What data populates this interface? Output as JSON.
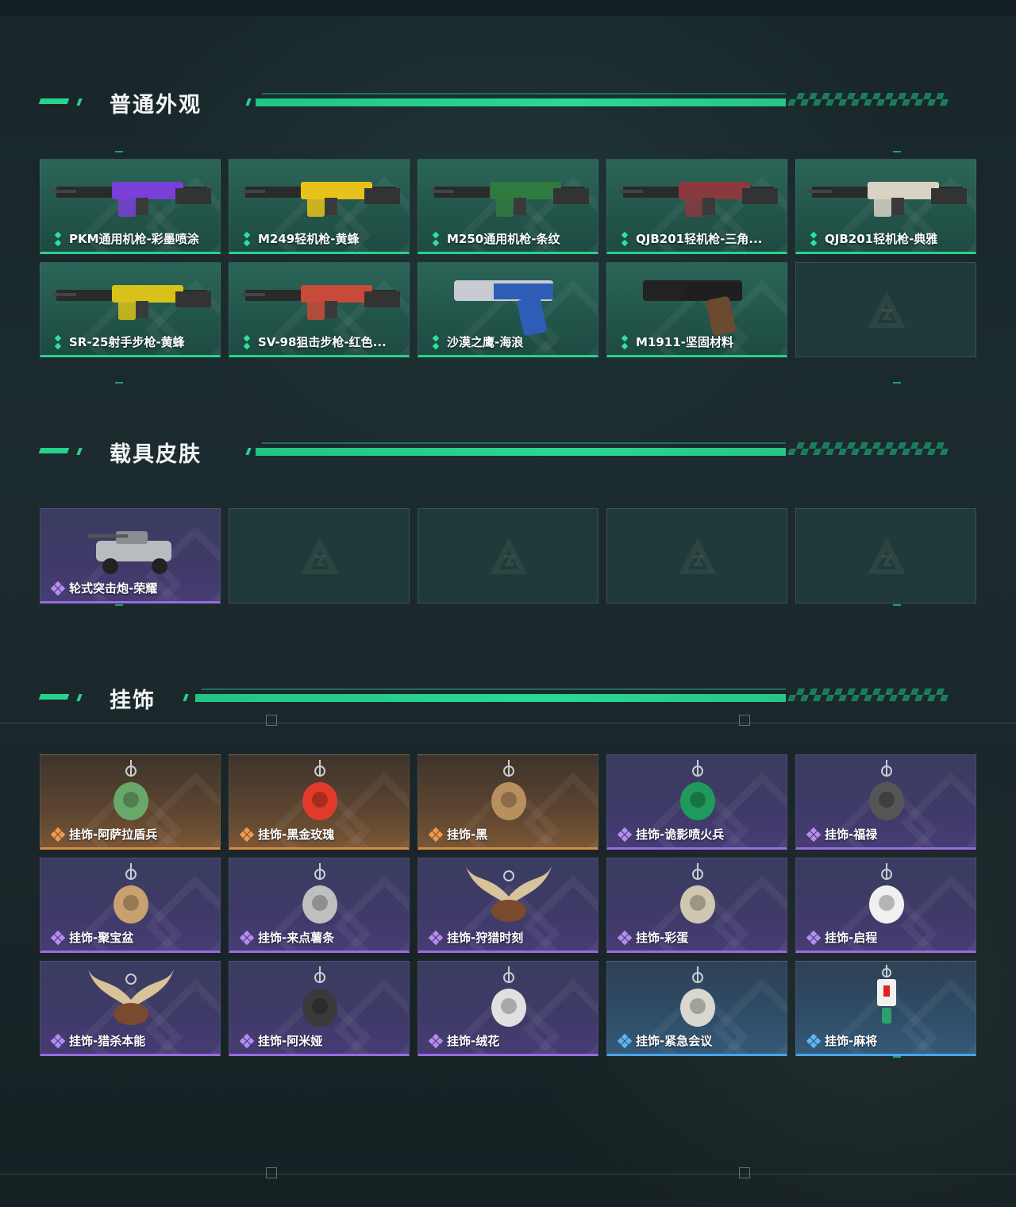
{
  "colors": {
    "accent": "#27d28d",
    "rarity_green": "#27d28d",
    "rarity_purple": "#9a6be0",
    "rarity_orange": "#d98a45",
    "rarity_blue": "#4aa4e8"
  },
  "sections": [
    {
      "title": "普通外观",
      "items": [
        {
          "label": "PKM通用机枪-彩墨喷涂",
          "rarity": "green",
          "icon": "lmg-skin-icon"
        },
        {
          "label": "M249轻机枪-黄蜂",
          "rarity": "green",
          "icon": "lmg-skin-icon"
        },
        {
          "label": "M250通用机枪-条纹",
          "rarity": "green",
          "icon": "lmg-skin-icon"
        },
        {
          "label": "QJB201轻机枪-三角...",
          "rarity": "green",
          "icon": "lmg-skin-icon"
        },
        {
          "label": "QJB201轻机枪-典雅",
          "rarity": "green",
          "icon": "lmg-skin-icon"
        },
        {
          "label": "SR-25射手步枪-黄蜂",
          "rarity": "green",
          "icon": "rifle-skin-icon"
        },
        {
          "label": "SV-98狙击步枪-红色...",
          "rarity": "green",
          "icon": "sniper-skin-icon"
        },
        {
          "label": "沙漠之鹰-海浪",
          "rarity": "green",
          "icon": "pistol-skin-icon"
        },
        {
          "label": "M1911-坚固材料",
          "rarity": "green",
          "icon": "pistol-skin-icon"
        },
        {
          "label": "",
          "rarity": "empty",
          "icon": "empty-slot-logo-icon"
        }
      ]
    },
    {
      "title": "载具皮肤",
      "items": [
        {
          "label": "轮式突击炮-荣耀",
          "rarity": "purple",
          "icon": "vehicle-skin-icon"
        },
        {
          "label": "",
          "rarity": "empty",
          "icon": "empty-slot-logo-icon"
        },
        {
          "label": "",
          "rarity": "empty",
          "icon": "empty-slot-logo-icon"
        },
        {
          "label": "",
          "rarity": "empty",
          "icon": "empty-slot-logo-icon"
        },
        {
          "label": "",
          "rarity": "empty",
          "icon": "empty-slot-logo-icon"
        }
      ]
    },
    {
      "title": "挂饰",
      "items": [
        {
          "label": "挂饰-阿萨拉盾兵",
          "rarity": "orange",
          "icon": "charm-icon"
        },
        {
          "label": "挂饰-黑金玫瑰",
          "rarity": "orange",
          "icon": "charm-icon"
        },
        {
          "label": "挂饰-黑",
          "rarity": "orange",
          "icon": "charm-icon"
        },
        {
          "label": "挂饰-诡影喷火兵",
          "rarity": "purple",
          "icon": "charm-icon"
        },
        {
          "label": "挂饰-福禄",
          "rarity": "purple",
          "icon": "charm-icon"
        },
        {
          "label": "挂饰-聚宝盆",
          "rarity": "purple",
          "icon": "charm-icon"
        },
        {
          "label": "挂饰-来点薯条",
          "rarity": "purple",
          "icon": "charm-icon"
        },
        {
          "label": "挂饰-狩猎时刻",
          "rarity": "purple",
          "icon": "antler-charm-icon"
        },
        {
          "label": "挂饰-彩蛋",
          "rarity": "purple",
          "icon": "charm-icon"
        },
        {
          "label": "挂饰-启程",
          "rarity": "purple",
          "icon": "charm-icon"
        },
        {
          "label": "挂饰-猎杀本能",
          "rarity": "purple",
          "icon": "antler-charm-icon"
        },
        {
          "label": "挂饰-阿米娅",
          "rarity": "purple",
          "icon": "charm-icon"
        },
        {
          "label": "挂饰-绒花",
          "rarity": "purple",
          "icon": "charm-icon"
        },
        {
          "label": "挂饰-紧急会议",
          "rarity": "blue",
          "icon": "charm-icon"
        },
        {
          "label": "挂饰-麻将",
          "rarity": "blue",
          "icon": "mahjong-charm-icon"
        }
      ]
    }
  ]
}
